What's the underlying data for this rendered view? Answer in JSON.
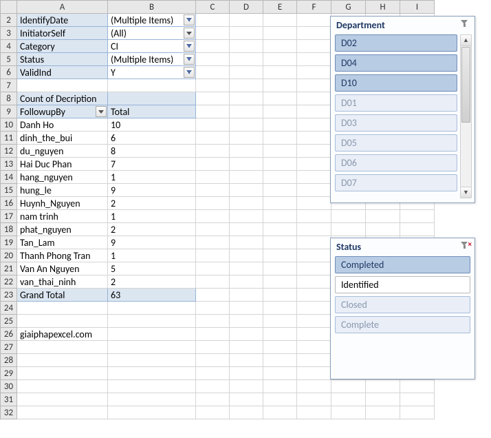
{
  "columns": [
    "A",
    "B",
    "C",
    "D",
    "E",
    "F",
    "G",
    "H",
    "I"
  ],
  "rows_start": 2,
  "rows_end": 32,
  "pivot_filters": [
    {
      "field": "IdentifyDate",
      "value": "(Multiple Items)",
      "filtered": true
    },
    {
      "field": "InitiatorSelf",
      "value": "(All)",
      "filtered": false
    },
    {
      "field": "Category",
      "value": "CI",
      "filtered": true
    },
    {
      "field": "Status",
      "value": "(Multiple Items)",
      "filtered": true
    },
    {
      "field": "ValidInd",
      "value": "Y",
      "filtered": true
    }
  ],
  "pivot_title": "Count of Decription",
  "pivot_rowlabel": "FollowupBy",
  "pivot_collabel": "Total",
  "pivot_rows": [
    {
      "name": "Danh Ho",
      "value": 10
    },
    {
      "name": "dinh_the_bui",
      "value": 6
    },
    {
      "name": "du_nguyen",
      "value": 8
    },
    {
      "name": "Hai Duc Phan",
      "value": 7
    },
    {
      "name": "hang_nguyen",
      "value": 1
    },
    {
      "name": "hung_le",
      "value": 9
    },
    {
      "name": "Huynh_Nguyen",
      "value": 2
    },
    {
      "name": "nam trinh",
      "value": 1
    },
    {
      "name": "phat_nguyen",
      "value": 2
    },
    {
      "name": "Tan_Lam",
      "value": 9
    },
    {
      "name": "Thanh Phong Tran",
      "value": 1
    },
    {
      "name": "Van An Nguyen",
      "value": 5
    },
    {
      "name": "van_thai_ninh",
      "value": 2
    }
  ],
  "grand_total_label": "Grand Total",
  "grand_total_value": 63,
  "footer_text": "giaiphapexcel.com",
  "slicer1": {
    "title": "Department",
    "clearable": false,
    "has_scroll": true,
    "items": [
      {
        "label": "D02",
        "selected": true
      },
      {
        "label": "D04",
        "selected": true
      },
      {
        "label": "D10",
        "selected": true
      },
      {
        "label": "D01",
        "selected": false
      },
      {
        "label": "D03",
        "selected": false
      },
      {
        "label": "D05",
        "selected": false
      },
      {
        "label": "D06",
        "selected": false
      },
      {
        "label": "D07",
        "selected": false
      }
    ]
  },
  "slicer2": {
    "title": "Status",
    "clearable": true,
    "has_scroll": false,
    "items": [
      {
        "label": "Completed",
        "selected": true
      },
      {
        "label": "Identified",
        "plain": true
      },
      {
        "label": "Closed",
        "selected": false
      },
      {
        "label": "Complete",
        "selected": false
      }
    ]
  }
}
